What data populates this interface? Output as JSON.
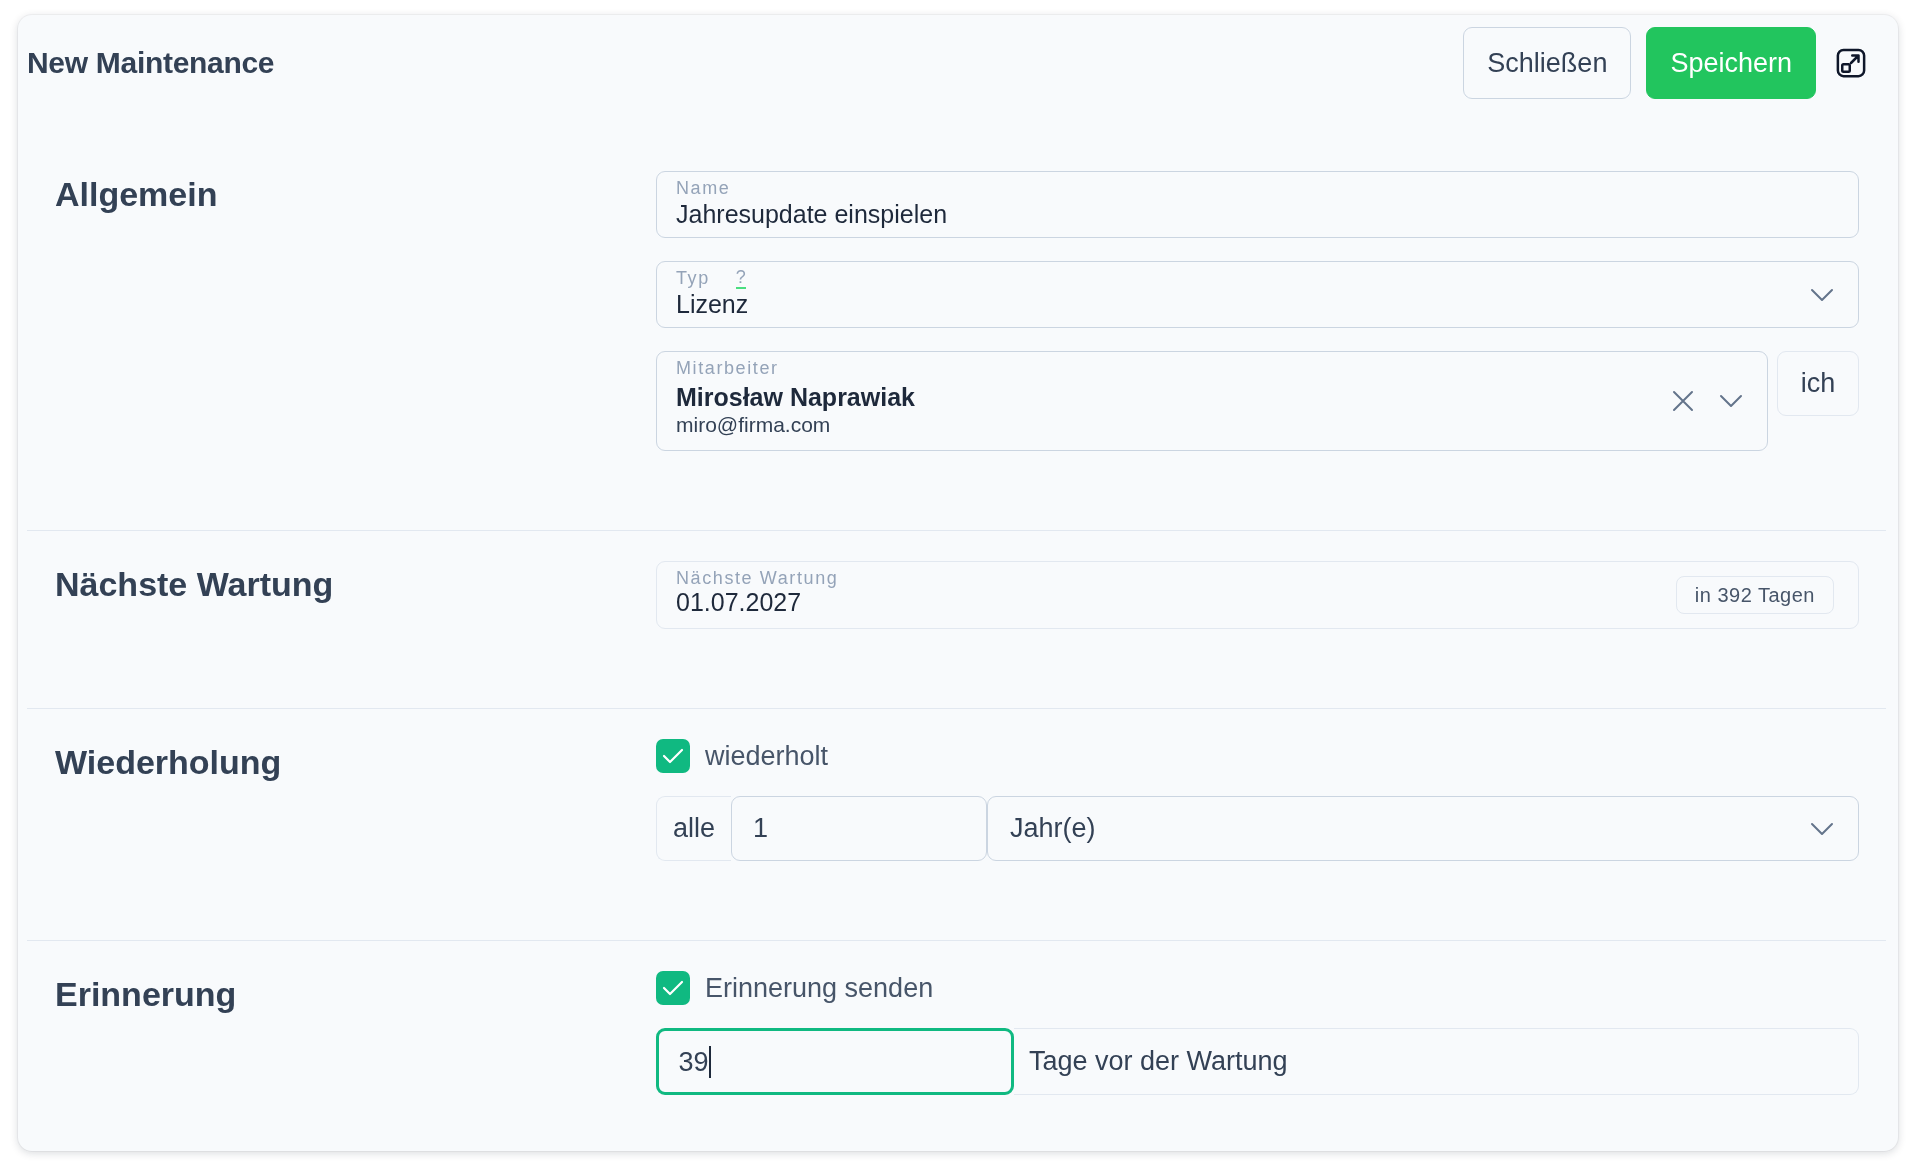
{
  "dialog": {
    "title": "New Maintenance",
    "buttons": [
      {
        "label": "Schließen",
        "kind": "secondary"
      },
      {
        "label": "Speichern",
        "kind": "primary"
      }
    ]
  },
  "sections": [
    {
      "title": "Allgemein",
      "fields": [
        {
          "kind": "text",
          "label": "Name",
          "value": "Jahresupdate einspielen"
        },
        {
          "kind": "select",
          "label": "Typ",
          "help": "?",
          "value": "Lizenz"
        },
        {
          "kind": "person",
          "label": "Mitarbeiter",
          "name": "Mirosław Naprawiak",
          "email": "miro@firma.com",
          "side_button": "ich"
        }
      ]
    },
    {
      "title": "Nächste Wartung",
      "fields": [
        {
          "kind": "date",
          "label": "Nächste Wartung",
          "value": "01.07.2027",
          "badge": "in 392 Tagen"
        }
      ]
    },
    {
      "title": "Wiederholung",
      "fields": [
        {
          "kind": "checkbox",
          "label": "wiederholt",
          "checked": true
        },
        {
          "kind": "interval",
          "prefix": "alle",
          "value": "1",
          "unit": "Jahr(e)"
        }
      ]
    },
    {
      "title": "Erinnerung",
      "fields": [
        {
          "kind": "checkbox",
          "label": "Erinnerung senden",
          "checked": true
        },
        {
          "kind": "days",
          "value": "39",
          "focused": true,
          "suffix": "Tage vor der Wartung"
        }
      ]
    }
  ]
}
